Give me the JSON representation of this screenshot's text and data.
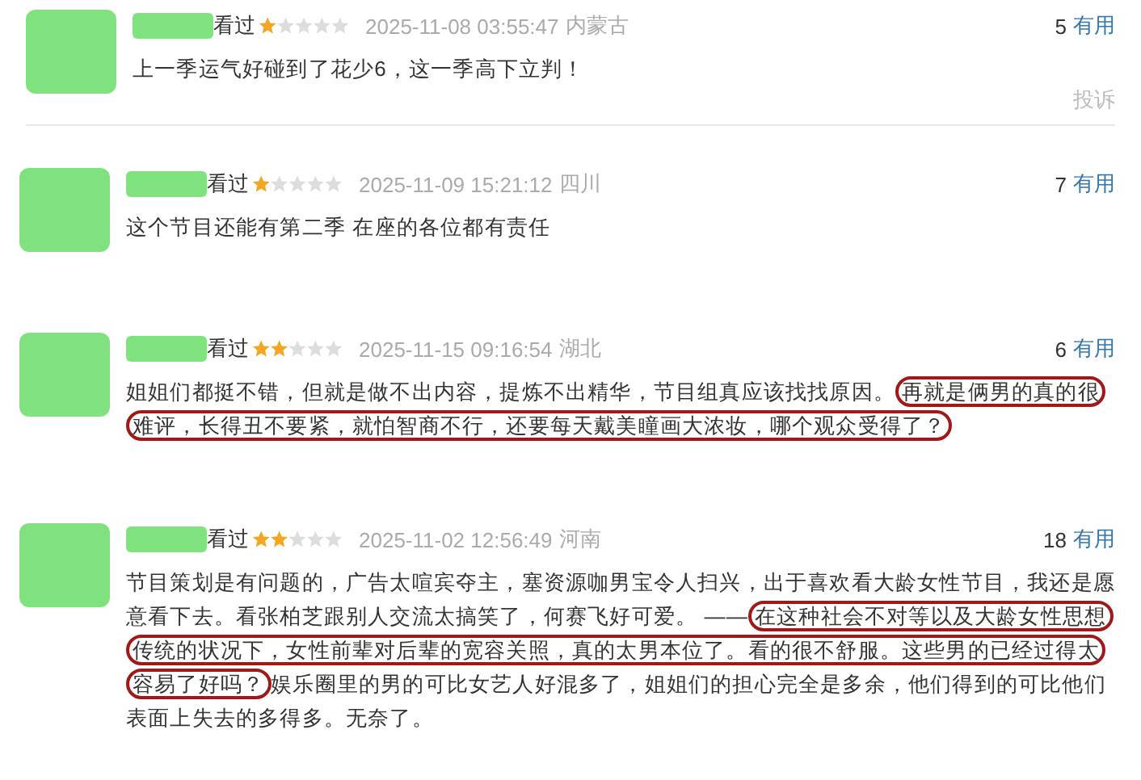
{
  "comments": [
    {
      "watched": "看过",
      "stars": 1,
      "time": "2025-11-08 03:55:47",
      "location": "内蒙古",
      "votes": "5",
      "useful": "有用",
      "segments": [
        {
          "text": "上一季运气好碰到了花少6，这一季高下立判！",
          "highlight": false
        }
      ],
      "report": "投诉",
      "divider_below": true
    },
    {
      "watched": "看过",
      "stars": 1,
      "time": "2025-11-09 15:21:12",
      "location": "四川",
      "votes": "7",
      "useful": "有用",
      "segments": [
        {
          "text": "这个节目还能有第二季 在座的各位都有责任",
          "highlight": false
        }
      ],
      "divider_below": false
    },
    {
      "watched": "看过",
      "stars": 2,
      "time": "2025-11-15 09:16:54",
      "location": "湖北",
      "votes": "6",
      "useful": "有用",
      "segments": [
        {
          "text": "姐姐们都挺不错，但就是做不出内容，提炼不出精华，节目组真应该找找原因。",
          "highlight": false
        },
        {
          "text": "再就是俩男的真的很难评，长得丑不要紧，就怕智商不行，还要每天戴美瞳画大浓妆，哪个观众受得了？",
          "highlight": true
        }
      ],
      "divider_below": false
    },
    {
      "watched": "看过",
      "stars": 2,
      "time": "2025-11-02 12:56:49",
      "location": "河南",
      "votes": "18",
      "useful": "有用",
      "segments": [
        {
          "text": "节目策划是有问题的，广告太喧宾夺主，塞资源咖男宝令人扫兴，出于喜欢看大龄女性节目，我还是愿意看下去。看张柏芝跟别人交流太搞笑了，何赛飞好可爱。 ——",
          "highlight": false
        },
        {
          "text": "在这种社会不对等以及大龄女性思想传统的状况下，女性前辈对后辈的宽容关照，真的太男本位了。看的很不舒服。这些男的已经过得太容易了好吗？",
          "highlight": true
        },
        {
          "text": "娱乐圈里的男的可比女艺人好混多了，姐姐们的担心完全是多余，他们得到的可比他们表面上失去的多得多。无奈了。",
          "highlight": false
        }
      ],
      "divider_below": false
    }
  ]
}
